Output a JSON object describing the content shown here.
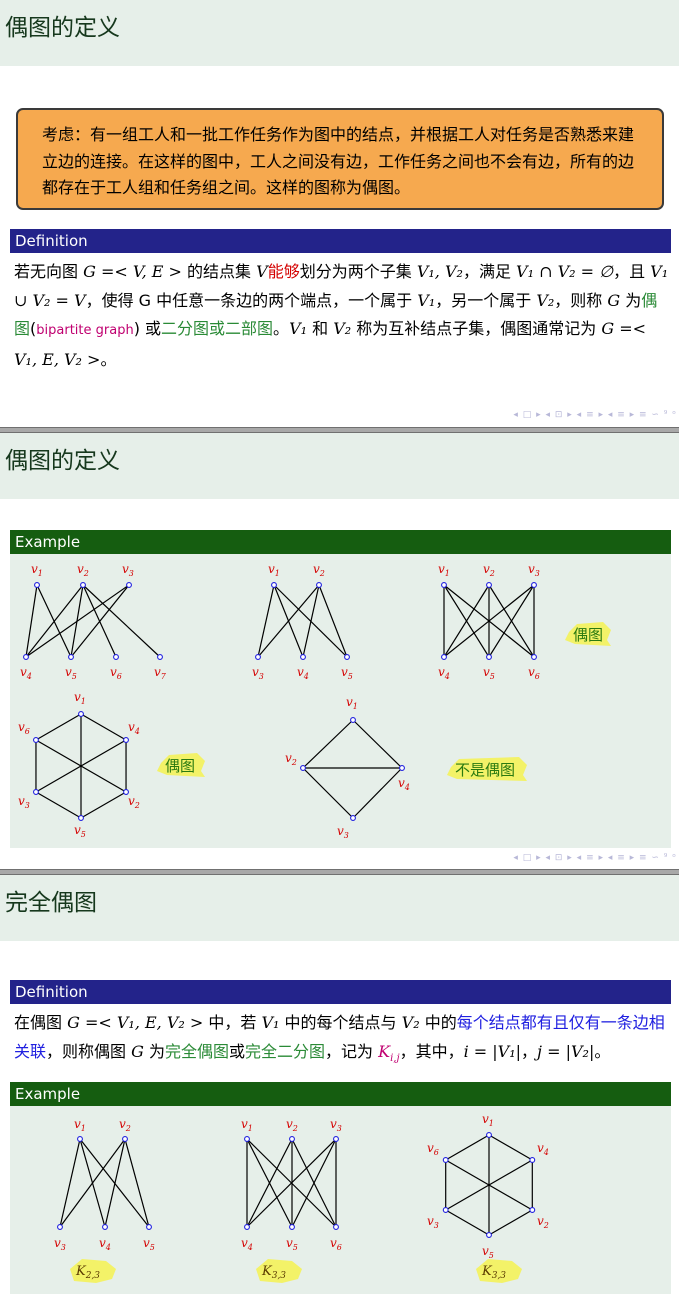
{
  "slide1": {
    "title": "偶图的定义",
    "consider": "考虑：有一组工人和一批工作任务作为图中的结点，并根据工人对任务是否熟悉来建立边的连接。在这样的图中，工人之间没有边，工作任务之间也不会有边，所有的边都存在于工人组和任务组之间。这样的图称为偶图。",
    "definition_label": "Definition",
    "def": {
      "p1": "若无向图 ",
      "m1": "G =< V, E >",
      "p2": " 的结点集 ",
      "m2": "V",
      "red1": "能够",
      "p3": "划分为两个子集 ",
      "m3": "V₁, V₂",
      "p4": "，满足 ",
      "m4": "V₁ ∩ V₂ = ∅",
      "p5": "，且 ",
      "m5": "V₁ ∪ V₂ = V",
      "p6": "，使得 G 中任意一条边的两个端点，一个属于 ",
      "m6": "V₁",
      "p7": "，另一个属于 ",
      "m7": "V₂",
      "p8": "，则称 ",
      "m8": "G",
      "p9": " 为",
      "g1": "偶图",
      "p10": "(",
      "mg1": "bipartite graph",
      "p11": ") 或",
      "g2": "二分图或二部图",
      "p12": "。",
      "m9": "V₁",
      "p13": " 和 ",
      "m10": "V₂",
      "p14": " 称为互补结点子集，偶图通常记为 ",
      "m11": "G =< V₁, E, V₂ >",
      "p15": "。"
    }
  },
  "slide2": {
    "title": "偶图的定义",
    "example_label": "Example",
    "g1_labels": [
      "v1",
      "v2",
      "v3",
      "v4",
      "v5",
      "v6",
      "v7"
    ],
    "g2_labels": [
      "v1",
      "v2",
      "v3",
      "v4",
      "v5"
    ],
    "g3_labels": [
      "v1",
      "v2",
      "v3",
      "v4",
      "v5",
      "v6"
    ],
    "g4_labels": [
      "v1",
      "v4",
      "v2",
      "v5",
      "v3",
      "v6"
    ],
    "g5_labels": [
      "v1",
      "v2",
      "v4",
      "v3"
    ],
    "hl_bipartite": "偶图",
    "hl_not": "不是偶图"
  },
  "slide3": {
    "title": "完全偶图",
    "definition_label": "Definition",
    "def": {
      "p1": "在偶图 ",
      "m1": "G =< V₁, E, V₂ >",
      "p2": " 中，若 ",
      "m2": "V₁",
      "p3": " 中的每个结点与 ",
      "m3": "V₂",
      "p4": " 中的",
      "b1": "每个结点都有且仅有一条边相关联",
      "p5": "，则称偶图 ",
      "m4": "G",
      "p6": " 为",
      "g1": "完全偶图",
      "p7": "或",
      "g2": "完全二分图",
      "p8": "，记为 ",
      "mag1": "K",
      "mag1sub": "i,j",
      "p9": "，其中，",
      "m5": "i = |V₁|",
      "p10": "，",
      "m6": "j = |V₂|",
      "p11": "。"
    },
    "example_label": "Example",
    "k23_labels": [
      "v1",
      "v2",
      "v3",
      "v4",
      "v5"
    ],
    "k33_labels": [
      "v1",
      "v2",
      "v3",
      "v4",
      "v5",
      "v6"
    ],
    "hex_labels": [
      "v1",
      "v4",
      "v2",
      "v5",
      "v3",
      "v6"
    ],
    "k_names": [
      "K2,3",
      "K3,3",
      "K3,3"
    ]
  },
  "nav_symbols": "◂ □ ▸ ◂ ⊡ ▸ ◂ ≡ ▸ ◂ ≡ ▸   ≡   ∽ ⁹ ᵒ"
}
